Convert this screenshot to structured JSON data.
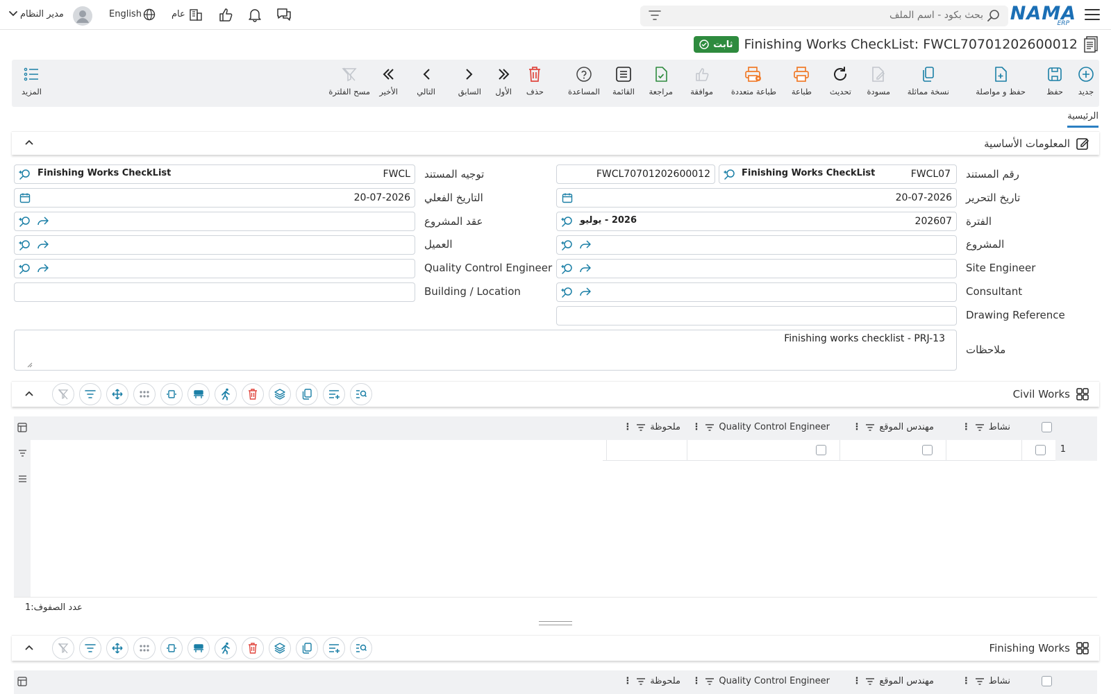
{
  "topbar": {
    "logo_text": "NAMA",
    "logo_sub": "ERP",
    "search_placeholder": "بحث بكود - اسم الملف",
    "user_name": "مدير النظام",
    "language": "English",
    "branch": "عام"
  },
  "document": {
    "title": "Finishing Works CheckList: FWCL70701202600012",
    "status": "ثابت"
  },
  "toolbar": {
    "new": "جديد",
    "save": "حفظ",
    "save_continue": "حفظ و مواصلة",
    "duplicate": "نسخة مماثلة",
    "draft": "مسودة",
    "refresh": "تحديث",
    "print": "طباعة",
    "multi_print": "طباعة متعددة",
    "approve": "موافقة",
    "review": "مراجعة",
    "list": "القائمة",
    "help": "المساعدة",
    "delete": "حذف",
    "first": "الأول",
    "previous": "السابق",
    "next": "التالي",
    "last": "الأخير",
    "clear_filter": "مسح الفلترة",
    "more": "المزيد"
  },
  "tabs": {
    "main": "الرئيسية"
  },
  "basic_info": {
    "section_title": "المعلومات الأساسية",
    "doc_number_label": "رقم المستند",
    "doc_number_code": "FWCL07",
    "doc_number_type": "Finishing Works CheckList",
    "doc_number_value": "FWCL70701202600012",
    "doc_direction_label": "توجيه المستند",
    "doc_direction_code": "FWCL",
    "doc_direction_type": "Finishing Works CheckList",
    "edit_date_label": "تاريخ التحرير",
    "edit_date": "20-07-2026",
    "actual_date_label": "التاريخ الفعلي",
    "actual_date": "20-07-2026",
    "period_label": "الفترة",
    "period_code": "202607",
    "period_name": "2026 - يوليو",
    "contract_label": "عقد المشروع",
    "project_label": "المشروع",
    "customer_label": "العميل",
    "site_engineer_label": "Site Engineer",
    "qc_engineer_label": "Quality Control Engineer",
    "consultant_label": "Consultant",
    "building_label": "Building / Location",
    "drawing_label": "Drawing Reference",
    "notes_label": "ملاحظات",
    "notes_value": "Finishing works checklist - PRJ-13"
  },
  "civil_works": {
    "section_title": "Civil Works",
    "columns": [
      "نشاط",
      "مهندس الموقع",
      "Quality Control Engineer",
      "ملحوظة"
    ],
    "rows": [
      {
        "num": "1"
      }
    ],
    "row_count_label": "عدد الصفوف:",
    "row_count": "1"
  },
  "finishing_works": {
    "section_title": "Finishing Works",
    "columns": [
      "نشاط",
      "مهندس الموقع",
      "Quality Control Engineer",
      "ملحوظة"
    ]
  },
  "colors": {
    "brand": "#1b6fb5",
    "accent_icon": "#1a7fa6",
    "success": "#2e8b3e",
    "danger": "#e0463e",
    "print": "#f07b2a"
  }
}
